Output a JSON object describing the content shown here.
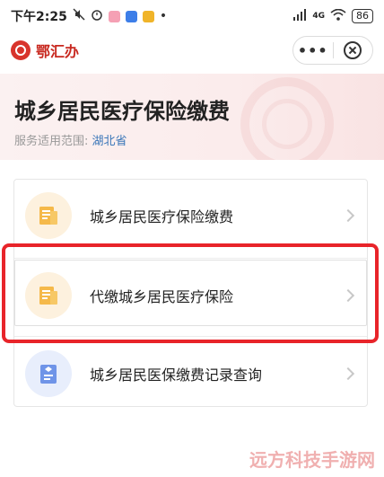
{
  "status_bar": {
    "time": "下午2:25",
    "network": "4G",
    "battery": "86"
  },
  "app": {
    "name": "鄂汇办",
    "more_label": "•••"
  },
  "banner": {
    "title": "城乡居民医疗保险缴费",
    "scope_label": "服务适用范围:",
    "scope_value": "湖北省"
  },
  "services": [
    {
      "label": "城乡居民医疗保险缴费",
      "icon": "document-icon"
    },
    {
      "label": "代缴城乡居民医疗保险",
      "icon": "document-icon"
    },
    {
      "label": "城乡居民医保缴费记录查询",
      "icon": "record-icon"
    }
  ],
  "site_watermark": "远方科技手游网",
  "colors": {
    "brand_red": "#c8281f",
    "highlight_red": "#e8242a",
    "scope_blue": "#3a76b8",
    "icon_orange": "#f5b94a",
    "icon_blue": "#6f94e8"
  }
}
